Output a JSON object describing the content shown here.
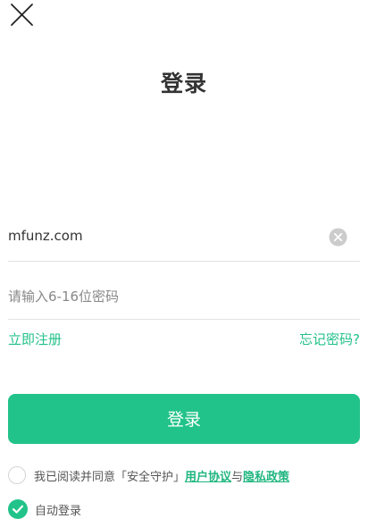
{
  "header": {
    "close_icon": "close-icon",
    "title": "登录"
  },
  "form": {
    "account_value": "mfunz.com",
    "clear_icon": "clear-icon",
    "password_placeholder": "请输入6-16位密码",
    "register_label": "立即注册",
    "forgot_label": "忘记密码?",
    "submit_label": "登录"
  },
  "agreement": {
    "prefix": "我已阅读并同意「安全守护」",
    "terms_label": "用户协议",
    "connector": "与",
    "privacy_label": "隐私政策",
    "checked": false
  },
  "auto_login": {
    "label": "自动登录",
    "checked": true
  },
  "colors": {
    "accent": "#22c38a",
    "divider": "#e3e3e3",
    "text": "#333333"
  }
}
